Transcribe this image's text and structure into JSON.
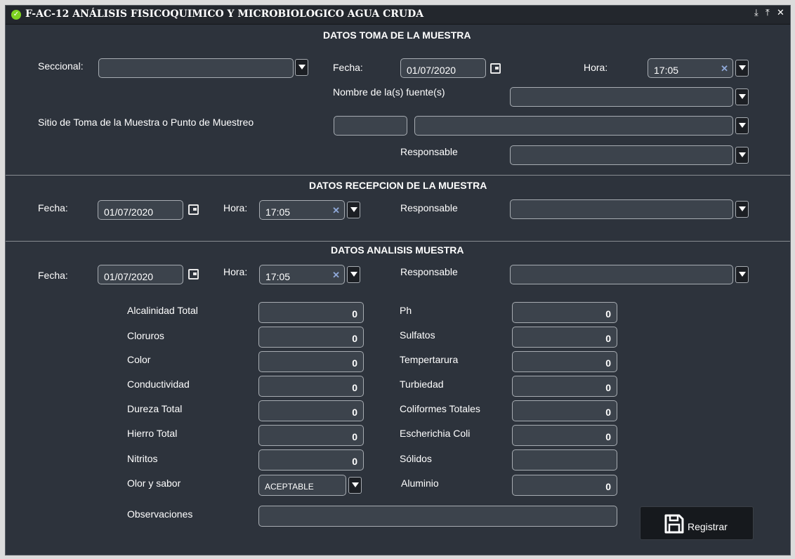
{
  "window": {
    "title": "F-AC-12 ANÁLISIS FISICOQUIMICO Y MICROBIOLOGICO AGUA CRUDA",
    "controls": [
      "⤓",
      "⤒",
      "✕"
    ]
  },
  "toma": {
    "title": "DATOS TOMA DE LA MUESTRA",
    "seccional_label": "Seccional:",
    "seccional_value": "",
    "fecha_label": "Fecha:",
    "fecha_value": "01/07/2020",
    "hora_label": "Hora:",
    "hora_value": "17:05",
    "fuente_label": "Nombre de la(s) fuente(s)",
    "fuente_value": "",
    "sitio_label": "Sitio de Toma de la Muestra o Punto de Muestreo",
    "sitio_code": "",
    "sitio_value": "",
    "responsable_label": "Responsable",
    "responsable_value": ""
  },
  "recepcion": {
    "title": "DATOS RECEPCION DE LA MUESTRA",
    "fecha_label": "Fecha:",
    "fecha_value": "01/07/2020",
    "hora_label": "Hora:",
    "hora_value": "17:05",
    "responsable_label": "Responsable",
    "responsable_value": ""
  },
  "analisis": {
    "title": "DATOS ANALISIS MUESTRA",
    "fecha_label": "Fecha:",
    "fecha_value": "01/07/2020",
    "hora_label": "Hora:",
    "hora_value": "17:05",
    "responsable_label": "Responsable",
    "responsable_value": "",
    "left": [
      {
        "label": "Alcalinidad Total",
        "value": "0"
      },
      {
        "label": "Cloruros",
        "value": "0"
      },
      {
        "label": "Color",
        "value": "0"
      },
      {
        "label": "Conductividad",
        "value": "0"
      },
      {
        "label": "Dureza Total",
        "value": "0"
      },
      {
        "label": "Hierro Total",
        "value": "0"
      },
      {
        "label": "Nitritos",
        "value": "0"
      },
      {
        "label": "Olor y sabor",
        "value": "ACEPTABLE"
      }
    ],
    "right": [
      {
        "label": "Ph",
        "value": "0"
      },
      {
        "label": "Sulfatos",
        "value": "0"
      },
      {
        "label": "Tempertarura",
        "value": "0"
      },
      {
        "label": "Turbiedad",
        "value": "0"
      },
      {
        "label": "Coliformes Totales",
        "value": "0"
      },
      {
        "label": "Escherichia Coli",
        "value": "0"
      },
      {
        "label": "Sólidos",
        "value": ""
      },
      {
        "label": "Aluminio",
        "value": "0"
      }
    ],
    "observaciones_label": "Observaciones",
    "observaciones_value": ""
  },
  "register_label": "Registrar",
  "icons": {
    "status": "check-circle-icon",
    "save": "floppy-disk-icon"
  }
}
